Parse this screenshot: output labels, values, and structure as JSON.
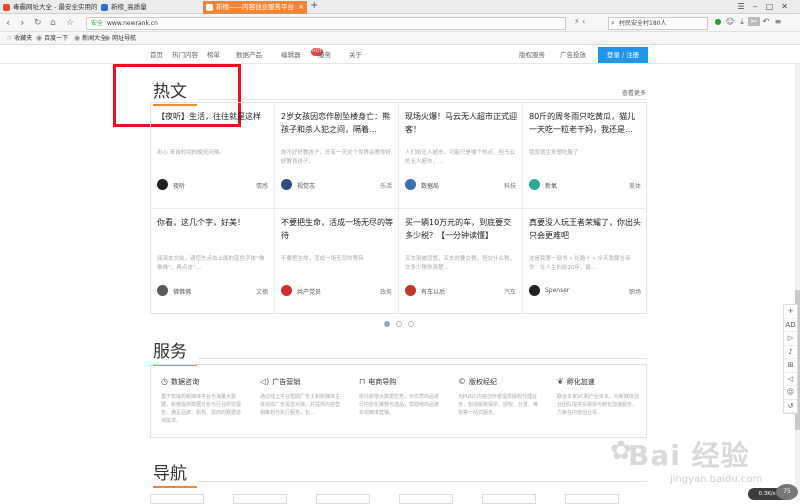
{
  "tabs": [
    {
      "label": "毒霸网址大全 - 最安全实用的网址导航",
      "color": "#e9472f"
    },
    {
      "label": "新榜_高质量",
      "color": "#2a6fd6"
    },
    {
      "label": "新榜——内容创业服务平台",
      "color": "#f0863a"
    }
  ],
  "toolbar": {
    "secure_label": "安全",
    "url": "www.newrank.cn",
    "search_text": "村民安全村180人"
  },
  "bookmarks": [
    {
      "icon": "star-icon",
      "label": "收藏夹"
    },
    {
      "icon": "globe-icon",
      "label": "百度一下"
    },
    {
      "icon": "globe-icon",
      "label": "新闻大全"
    },
    {
      "icon": "globe-icon",
      "label": "网址导航"
    }
  ],
  "nav": {
    "items": [
      "首页",
      "热门内容",
      "榜单",
      "数据产品",
      "编辑器",
      "服务",
      "关于"
    ],
    "hot_badge": "HOT",
    "right_items": [
      "版权服务",
      "广告投放"
    ],
    "login": "登录 / 注册"
  },
  "hot": {
    "title": "热文",
    "more": "查看更多",
    "cards": [
      {
        "title": "【夜听】生活，往往就是这样",
        "desc": "用心 来自时间的晚安问候。",
        "author": "夜听",
        "category": "情感",
        "avatar_color": "#1f1f1f"
      },
      {
        "title": "2岁女孩因恋作剧坠楼身亡：熊孩子和杀人犯之间，隔着…",
        "desc": "你不好好教孩子，总有一天这个世界会教你好好教育孩子。",
        "author": "视觉志",
        "category": "乐活",
        "avatar_color": "#2f4f7f"
      },
      {
        "title": "现场火爆！马云无人超市正式迎客！",
        "desc": "人们的无人超市，可能只是噱个热点，但马云的无人超市，…",
        "author": "数据局",
        "category": "科技",
        "avatar_color": "#3a6fb0"
      },
      {
        "title": "80斤的周冬雨只吃黄瓜，猫儿一天吃一粒老干妈，我还是…",
        "desc": "我寂寞生来想吃胀了",
        "author": "新氧",
        "category": "美体",
        "avatar_color": "#2aa89a"
      },
      {
        "title": "你看，这几个字，好美！",
        "desc": "阅读本文前，请您先点击上面的蓝色字体“佛佛佛”，再点击“…",
        "author": "佛佛佛",
        "category": "文摘",
        "avatar_color": "#5a5a5a"
      },
      {
        "title": "不要把生命，活成一场无尽的等待",
        "desc": "不要把生命，活成一场无尽的等待",
        "author": "共产党员",
        "category": "政务",
        "avatar_color": "#d32f2f"
      },
      {
        "title": "买一辆10万元的车，到底要交多少税？【一分钟读懂】",
        "desc": "买车别被忽悠，买车时要交税，但交什么税，交多少税你清楚…",
        "author": "有车以后",
        "category": "汽车",
        "avatar_color": "#c0392b"
      },
      {
        "title": "真要没人玩王者荣耀了，你出头只会更难吧",
        "desc": "这是我第一部书 • 长路十 • 今天我要告诉你：在人生的前20年，最…",
        "author": "Spenser",
        "category": "职场",
        "avatar_color": "#222222"
      }
    ]
  },
  "carousel": {
    "pages": 3,
    "active": 0
  },
  "services": {
    "title": "服务",
    "items": [
      {
        "icon": "clock-icon",
        "name": "数据咨询",
        "desc": "基于权威的新媒体平台与海量大数据，新榜提供数据分析与行业研究报告，满足品牌、机构、政府的数据咨询需求。"
      },
      {
        "icon": "megaphone-icon",
        "name": "广告营销",
        "desc": "通过线上平台帮助广告主和新媒体主体完成广告投放对接，并提供内容营销策划与执行服务，包…"
      },
      {
        "icon": "bag-icon",
        "name": "电商导购",
        "desc": "依托新榜大数据优势，对优质商品进行内容化推荐与选品，帮助电商品牌实现精准营销。"
      },
      {
        "icon": "copyright-icon",
        "name": "版权经纪",
        "desc": "为PUGC内容创作者提供版权代理业务，包括版权保护、授权、分发、维权等一站式服务。"
      },
      {
        "icon": "sprout-icon",
        "name": "孵化加速",
        "desc": "联合多家VC和产业资本，为新媒体创业团队提供投融资与孵化加速服务，力争在内容创业领…"
      }
    ]
  },
  "navigation": {
    "title": "导航"
  },
  "sidebar": [
    "+",
    "AD",
    "▷",
    "♪",
    "⊞",
    "◁",
    "☺",
    "↺"
  ],
  "watermark": {
    "brand": "Bai 经验",
    "site": "jingyan.baidu.com"
  },
  "status": {
    "speed": "0.3K/s",
    "zoom": "75"
  }
}
